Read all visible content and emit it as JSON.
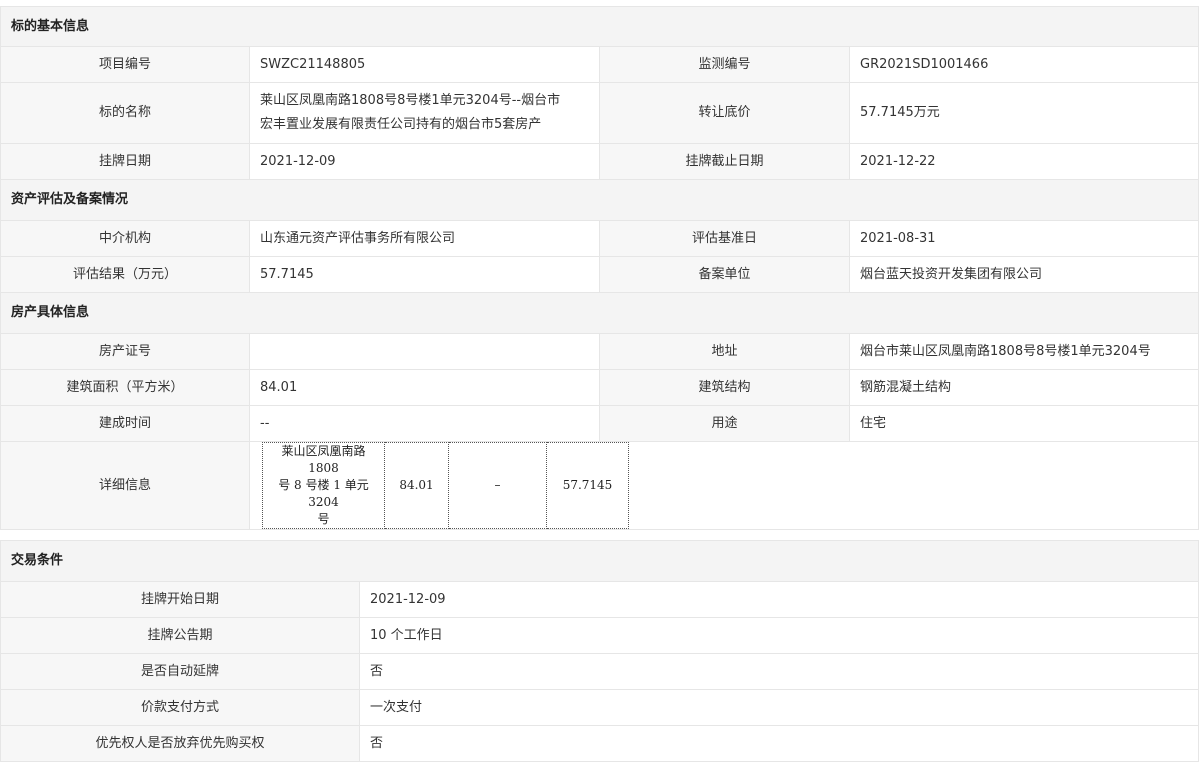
{
  "section_basic": {
    "title": "标的基本信息",
    "project_no_label": "项目编号",
    "project_no": "SWZC21148805",
    "monitor_no_label": "监测编号",
    "monitor_no": "GR2021SD1001466",
    "name_label": "标的名称",
    "name_line1": "莱山区凤凰南路1808号8号楼1单元3204号--烟台市",
    "name_line2": "宏丰置业发展有限责任公司持有的烟台市5套房产",
    "price_label": "转让底价",
    "price": "57.7145万元",
    "list_date_label": "挂牌日期",
    "list_date": "2021-12-09",
    "list_end_label": "挂牌截止日期",
    "list_end": "2021-12-22"
  },
  "section_asset": {
    "title": "资产评估及备案情况",
    "agency_label": "中介机构",
    "agency": "山东通元资产评估事务所有限公司",
    "base_date_label": "评估基准日",
    "base_date": "2021-08-31",
    "result_label": "评估结果（万元）",
    "result": "57.7145",
    "filing_label": "备案单位",
    "filing": "烟台蓝天投资开发集团有限公司"
  },
  "section_property": {
    "title": "房产具体信息",
    "cert_label": "房产证号",
    "cert": "",
    "address_label": "地址",
    "address": "烟台市莱山区凤凰南路1808号8号楼1单元3204号",
    "area_label": "建筑面积（平方米）",
    "area": "84.01",
    "structure_label": "建筑结构",
    "structure": "钢筋混凝土结构",
    "built_label": "建成时间",
    "built": "--",
    "usage_label": "用途",
    "usage": "住宅",
    "detail_label": "详细信息",
    "detail": {
      "addr_line1": "莱山区凤凰南路 1808",
      "addr_line2": "号 8 号楼 1 单元 3204",
      "addr_line3": "号",
      "area": "84.01",
      "dash": "–",
      "value": "57.7145"
    }
  },
  "section_trade": {
    "title": "交易条件",
    "start_label": "挂牌开始日期",
    "start": "2021-12-09",
    "period_label": "挂牌公告期",
    "period": "10 个工作日",
    "auto_label": "是否自动延牌",
    "auto": "否",
    "pay_label": "价款支付方式",
    "pay": "一次支付",
    "priority_label": "优先权人是否放弃优先购买权",
    "priority": "否"
  }
}
